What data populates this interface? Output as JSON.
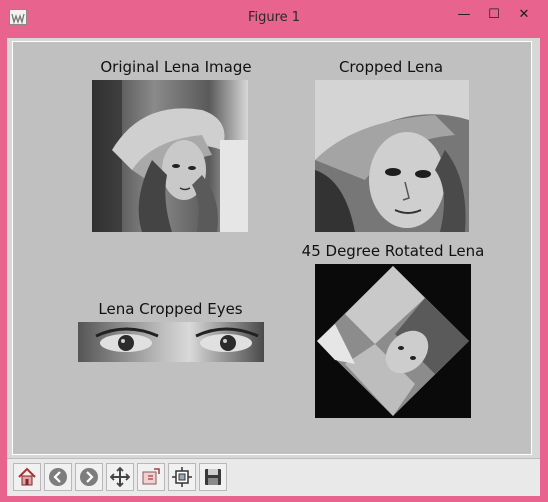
{
  "window": {
    "title": "Figure 1",
    "controls": {
      "minimize": "—",
      "maximize": "☐",
      "close": "✕"
    }
  },
  "figure": {
    "subplots": [
      {
        "title": "Original Lena Image"
      },
      {
        "title": "Cropped Lena"
      },
      {
        "title": "Lena Cropped Eyes"
      },
      {
        "title": "45 Degree Rotated Lena"
      }
    ]
  },
  "toolbar": {
    "buttons": [
      {
        "icon": "home-icon"
      },
      {
        "icon": "back-arrow-icon"
      },
      {
        "icon": "forward-arrow-icon"
      },
      {
        "icon": "pan-icon"
      },
      {
        "icon": "zoom-rect-icon"
      },
      {
        "icon": "configure-subplots-icon"
      },
      {
        "icon": "save-icon"
      }
    ]
  },
  "colors": {
    "frame": "#e8648e",
    "figure_bg": "#c0c0c0"
  }
}
